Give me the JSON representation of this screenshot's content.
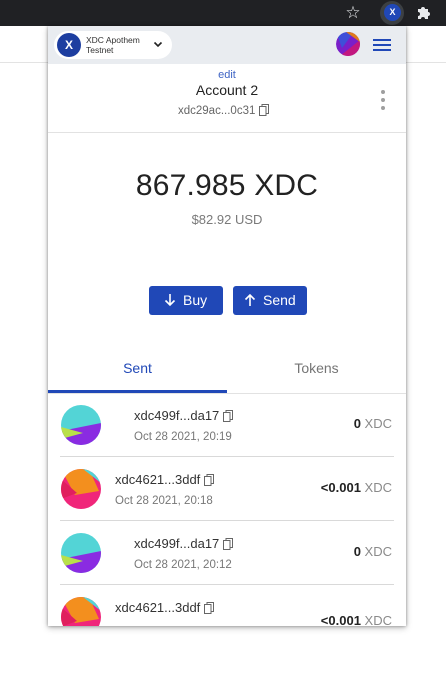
{
  "browser": {
    "star_icon": "star-icon",
    "extension_icon": "xdc-extension-icon",
    "extension_glyph": "X",
    "puzzle_icon": "puzzle-icon"
  },
  "topbar": {
    "network_logo": "X",
    "network_label": "XDC Apothem Testnet",
    "network_caret": "chevron-down-icon",
    "account_avatar": "account-avatar",
    "menu_icon": "hamburger-menu-icon"
  },
  "account": {
    "edit_label": "edit",
    "name": "Account 2",
    "address": "xdc29ac...0c31"
  },
  "balance": {
    "amount": "867.985 XDC",
    "fiat": "$82.92 USD"
  },
  "actions": {
    "buy_label": "Buy",
    "send_label": "Send"
  },
  "tabs": {
    "sent": "Sent",
    "tokens": "Tokens",
    "active": "sent"
  },
  "transactions": [
    {
      "address": "xdc499f...da17",
      "date": "Oct 28 2021, 20:19",
      "amount": "0",
      "unit": "XDC",
      "avatar": "teal-purple"
    },
    {
      "address": "xdc4621...3ddf",
      "date": "Oct 28 2021, 20:18",
      "amount": "<0.001",
      "unit": "XDC",
      "avatar": "orange-pink"
    },
    {
      "address": "xdc499f...da17",
      "date": "Oct 28 2021, 20:12",
      "amount": "0",
      "unit": "XDC",
      "avatar": "teal-purple"
    },
    {
      "address": "xdc4621...3ddf",
      "date": "",
      "amount": "<0.001",
      "unit": "XDC",
      "avatar": "orange-pink"
    }
  ],
  "colors": {
    "accent": "#2048b7",
    "topbar_bg": "#e9ecf0",
    "chrome_bg": "#202124"
  }
}
